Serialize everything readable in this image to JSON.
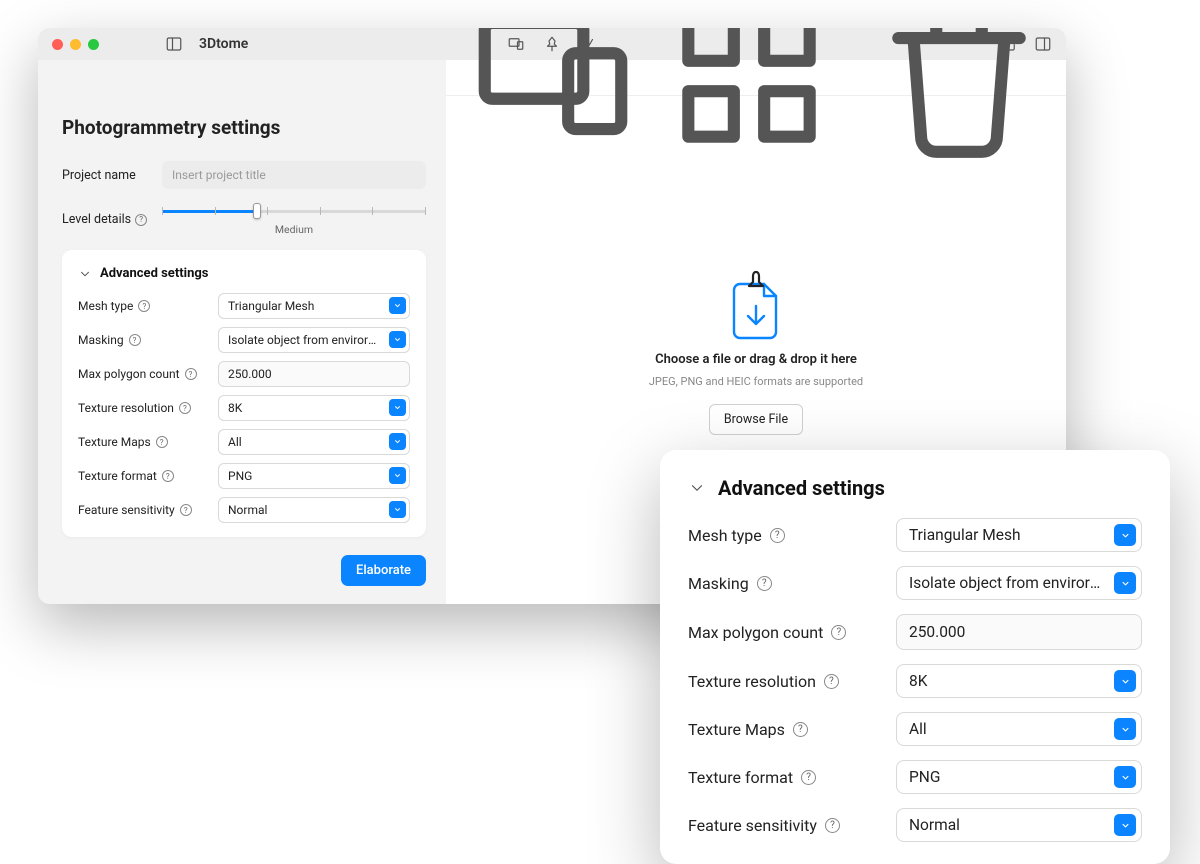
{
  "app_name": "3Dtome",
  "sidebar": {
    "title": "Photogrammetry settings",
    "project_name_label": "Project name",
    "project_name_placeholder": "Insert project title",
    "level_details_label": "Level details",
    "level_details_value": "Medium"
  },
  "advanced": {
    "title": "Advanced settings",
    "rows": {
      "mesh_type": {
        "label": "Mesh type",
        "value": "Triangular Mesh"
      },
      "masking": {
        "label": "Masking",
        "value": "Isolate object from envirorm..."
      },
      "max_polygon": {
        "label": "Max polygon count",
        "value": "250.000"
      },
      "texture_resolution": {
        "label": "Texture resolution",
        "value": "8K"
      },
      "texture_maps": {
        "label": "Texture Maps",
        "value": "All"
      },
      "texture_format": {
        "label": "Texture format",
        "value": "PNG"
      },
      "feature_sensitivity": {
        "label": "Feature sensitivity",
        "value": "Normal"
      }
    }
  },
  "zoom_advanced": {
    "title": "Advanced settings",
    "rows": {
      "mesh_type": {
        "label": "Mesh type",
        "value": "Triangular Mesh"
      },
      "masking": {
        "label": "Masking",
        "value": "Isolate object from envirorm..."
      },
      "max_polygon": {
        "label": "Max polygon count",
        "value": "250.000"
      },
      "texture_resolution": {
        "label": "Texture resolution",
        "value": "8K"
      },
      "texture_maps": {
        "label": "Texture Maps",
        "value": "All"
      },
      "texture_format": {
        "label": "Texture format",
        "value": "PNG"
      },
      "feature_sensitivity": {
        "label": "Feature sensitivity",
        "value": "Normal"
      }
    }
  },
  "elaborate_label": "Elaborate",
  "dropzone": {
    "title": "Choose a file or drag & drop it here",
    "sub": "JPEG, PNG and HEIC formats are supported",
    "browse_label": "Browse File"
  },
  "colors": {
    "accent": "#0a84ff"
  }
}
